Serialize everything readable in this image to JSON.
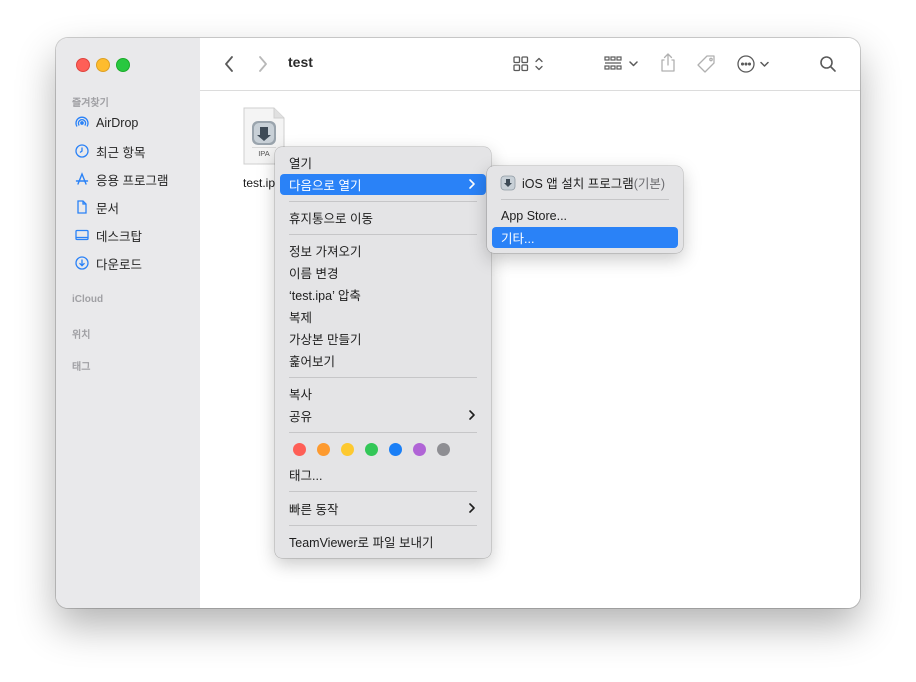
{
  "toolbar": {
    "title": "test"
  },
  "sidebar": {
    "favorites_label": "즐겨찾기",
    "items": [
      {
        "label": "AirDrop",
        "icon": "airdrop-icon"
      },
      {
        "label": "최근 항목",
        "icon": "clock-icon"
      },
      {
        "label": "응용 프로그램",
        "icon": "applications-icon"
      },
      {
        "label": "문서",
        "icon": "document-icon"
      },
      {
        "label": "데스크탑",
        "icon": "desktop-icon"
      },
      {
        "label": "다운로드",
        "icon": "download-icon"
      }
    ],
    "icloud_label": "iCloud",
    "locations_label": "위치",
    "tags_label": "태그"
  },
  "file": {
    "name": "test.ip",
    "icon_text": "IPA"
  },
  "context_menu": {
    "open": "열기",
    "open_with": "다음으로 열기",
    "move_to_trash": "휴지통으로 이동",
    "get_info": "정보 가져오기",
    "rename": "이름 변경",
    "compress": "‘test.ipa’ 압축",
    "duplicate": "복제",
    "make_alias": "가상본 만들기",
    "quick_look": "훑어보기",
    "copy": "복사",
    "share": "공유",
    "tags": "태그...",
    "quick_actions": "빠른 동작",
    "teamviewer": "TeamViewer로 파일 보내기",
    "tag_colors": [
      "#fe5f57",
      "#fd9a2f",
      "#fdc930",
      "#33c758",
      "#1a7ff6",
      "#b064d6",
      "#8e8e93"
    ]
  },
  "submenu": {
    "installer_name": "iOS 앱 설치 프로그램",
    "installer_default": "(기본)",
    "app_store": "App Store...",
    "other": "기타..."
  },
  "colors": {
    "accent": "#2a82f7",
    "sidebar_bg": "#e9e9eb"
  }
}
